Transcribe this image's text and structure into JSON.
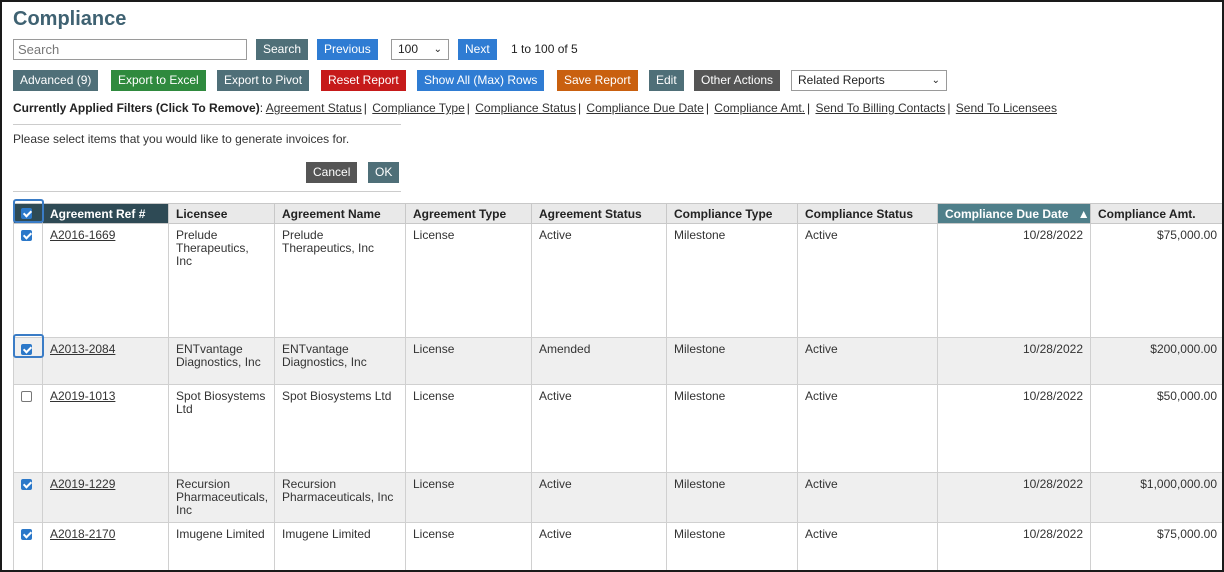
{
  "page": {
    "title": "Compliance"
  },
  "search": {
    "placeholder": "Search",
    "button": "Search"
  },
  "paging": {
    "previous": "Previous",
    "page_size": "100",
    "next": "Next",
    "range_text": "1 to 100 of 5"
  },
  "toolbar": {
    "advanced": "Advanced (9)",
    "export_excel": "Export to Excel",
    "export_pivot": "Export to Pivot",
    "reset_report": "Reset Report",
    "show_all": "Show All (Max) Rows",
    "save_report": "Save Report",
    "edit": "Edit",
    "other_actions": "Other Actions",
    "related_reports": "Related Reports"
  },
  "filters": {
    "label": "Currently Applied Filters (Click To Remove)",
    "items": [
      "Agreement Status",
      "Compliance Type",
      "Compliance Status",
      "Compliance Due Date",
      "Compliance Amt.",
      "Send To Billing Contacts",
      "Send To Licensees"
    ]
  },
  "invoice": {
    "message": "Please select items that you would like to generate invoices for.",
    "cancel": "Cancel",
    "ok": "OK"
  },
  "table": {
    "columns": [
      "Agreement Ref #",
      "Licensee",
      "Agreement Name",
      "Agreement Type",
      "Agreement Status",
      "Compliance Type",
      "Compliance Status",
      "Compliance Due Date",
      "Compliance Amt."
    ],
    "sort_indicator": "▲",
    "rows": [
      {
        "checked": true,
        "ref": "A2016-1669",
        "licensee": "Prelude Therapeutics, Inc",
        "agreement_name": "Prelude Therapeutics, Inc",
        "agreement_type": "License",
        "agreement_status": "Active",
        "compliance_type": "Milestone",
        "compliance_status": "Active",
        "due_date": "10/28/2022",
        "amount": "$75,000.00"
      },
      {
        "checked": true,
        "ref": "A2013-2084",
        "licensee": "ENTvantage Diagnostics, Inc",
        "agreement_name": "ENTvantage Diagnostics, Inc",
        "agreement_type": "License",
        "agreement_status": "Amended",
        "compliance_type": "Milestone",
        "compliance_status": "Active",
        "due_date": "10/28/2022",
        "amount": "$200,000.00"
      },
      {
        "checked": false,
        "ref": "A2019-1013",
        "licensee": "Spot Biosystems Ltd",
        "agreement_name": "Spot Biosystems Ltd",
        "agreement_type": "License",
        "agreement_status": "Active",
        "compliance_type": "Milestone",
        "compliance_status": "Active",
        "due_date": "10/28/2022",
        "amount": "$50,000.00"
      },
      {
        "checked": true,
        "ref": "A2019-1229",
        "licensee": "Recursion Pharmaceuticals, Inc",
        "agreement_name": "Recursion Pharmaceuticals, Inc",
        "agreement_type": "License",
        "agreement_status": "Active",
        "compliance_type": "Milestone",
        "compliance_status": "Active",
        "due_date": "10/28/2022",
        "amount": "$1,000,000.00"
      },
      {
        "checked": true,
        "ref": "A2018-2170",
        "licensee": "Imugene Limited",
        "agreement_name": "Imugene Limited",
        "agreement_type": "License",
        "agreement_status": "Active",
        "compliance_type": "Milestone",
        "compliance_status": "Active",
        "due_date": "10/28/2022",
        "amount": "$75,000.00"
      }
    ]
  },
  "colors": {
    "title": "#3f6272",
    "slate": "#4f6f78",
    "blue": "#2f7cd3",
    "green": "#2f8a3e",
    "red": "#c61a1a",
    "orange": "#c9600f",
    "dark": "#555555",
    "header_dark": "#2e4a55",
    "header_sorted": "#4f7f8a",
    "highlight": "#3a7cc6"
  }
}
